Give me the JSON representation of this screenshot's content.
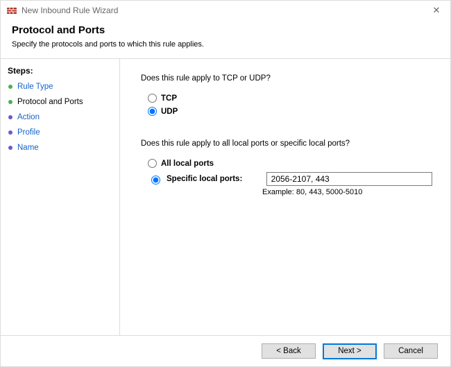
{
  "window": {
    "title": "New Inbound Rule Wizard"
  },
  "header": {
    "title": "Protocol and Ports",
    "subtitle": "Specify the protocols and ports to which this rule applies."
  },
  "sidebar": {
    "steps_heading": "Steps:",
    "items": [
      {
        "label": "Rule Type",
        "state": "completed"
      },
      {
        "label": "Protocol and Ports",
        "state": "current"
      },
      {
        "label": "Action",
        "state": "upcoming"
      },
      {
        "label": "Profile",
        "state": "upcoming"
      },
      {
        "label": "Name",
        "state": "upcoming"
      }
    ]
  },
  "content": {
    "protocol_question": "Does this rule apply to TCP or UDP?",
    "protocol_options": {
      "tcp": "TCP",
      "udp": "UDP",
      "selected": "udp"
    },
    "ports_question": "Does this rule apply to all local ports or specific local ports?",
    "ports_options": {
      "all": "All local ports",
      "specific": "Specific local ports:",
      "selected": "specific"
    },
    "specific_ports_value": "2056-2107, 443",
    "example_label": "Example: 80, 443, 5000-5010"
  },
  "footer": {
    "back": "< Back",
    "next": "Next >",
    "cancel": "Cancel"
  }
}
